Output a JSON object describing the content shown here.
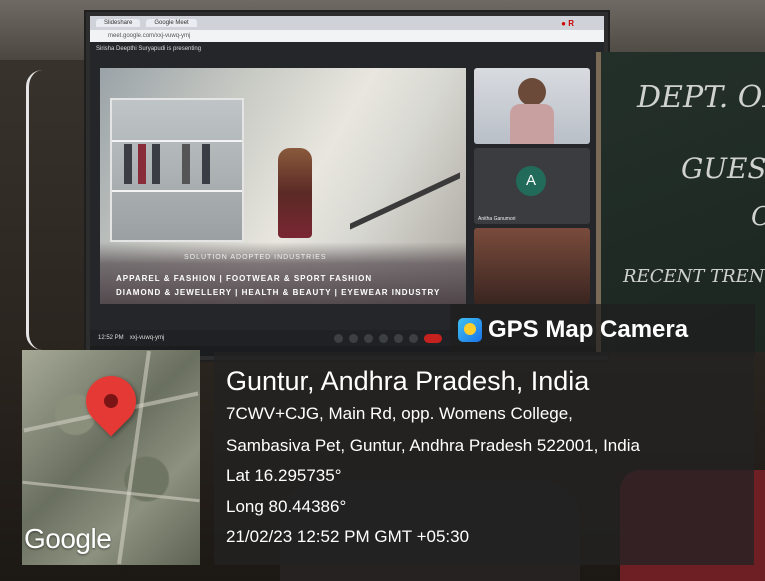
{
  "browser": {
    "tab1": "Slideshare",
    "tab2": "Google Meet",
    "tab3": "",
    "url": "meet.google.com/xxj-vuwq-ymj"
  },
  "meet": {
    "presenting_label": "Sirisha Deepthi Suryapudi is presenting",
    "participant_initial": "A",
    "participant_name": "Anitha Ganumori",
    "time": "12:52 PM",
    "meeting_code": "xxj-vuwq-ymj"
  },
  "slide": {
    "section_title": "SOLUTION ADOPTED INDUSTRIES",
    "line1": "APPAREL & FASHION | FOOTWEAR & SPORT FASHION",
    "line2": "DIAMOND & JEWELLERY | HEALTH & BEAUTY | EYEWEAR INDUSTRY"
  },
  "chalkboard": {
    "line1": "DEPT. OF",
    "line2": "GUEST",
    "line3": "O",
    "line4": "RECENT TREN"
  },
  "gps": {
    "app_name": "GPS Map Camera",
    "icon": "gps-map-camera-icon",
    "location_title": "Guntur, Andhra Pradesh, India",
    "address_line1": "7CWV+CJG, Main Rd, opp. Womens College,",
    "address_line2": "Sambasiva Pet, Guntur, Andhra Pradesh 522001, India",
    "lat": "Lat 16.295735°",
    "long": "Long 80.44386°",
    "datetime": "21/02/23 12:52 PM GMT +05:30",
    "map_logo": "Google",
    "pin_color": "#e53935"
  }
}
